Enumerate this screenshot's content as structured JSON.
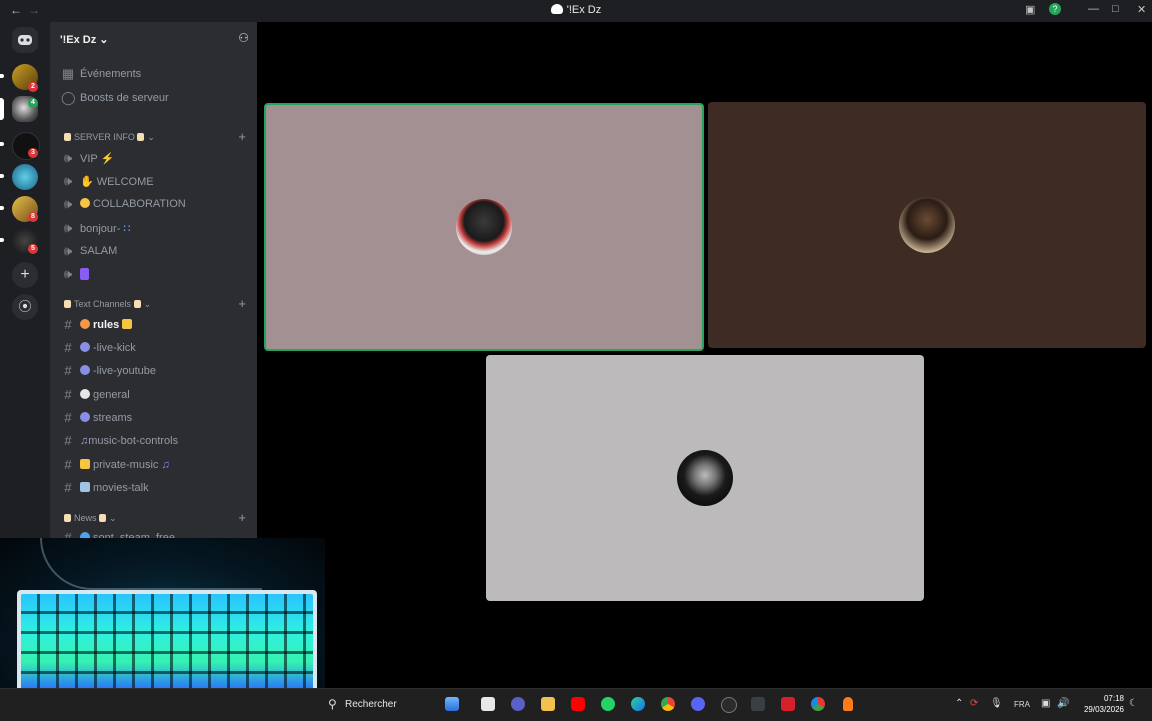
{
  "window": {
    "title": "'!Ex Dz"
  },
  "server": {
    "name": "'!Ex Dz",
    "top_items": [
      "Événements",
      "Boosts de serveur"
    ],
    "badges": [
      "2",
      "4",
      "3",
      "8",
      "8",
      "5"
    ]
  },
  "categories": {
    "server_info": "SERVER INFO",
    "text_channels": "Text Channels",
    "news": "News"
  },
  "voice_channels": [
    {
      "label": "VIP"
    },
    {
      "label": "WELCOME"
    },
    {
      "label": "COLLABORATION"
    },
    {
      "label": "bonjour-"
    },
    {
      "label": "SALAM"
    },
    {
      "label": ""
    }
  ],
  "text_channels": [
    {
      "label": "rules"
    },
    {
      "label": "-live-kick"
    },
    {
      "label": "-live-youtube"
    },
    {
      "label": "general"
    },
    {
      "label": "streams"
    },
    {
      "label": "music-bot-controls"
    },
    {
      "label": "private-music"
    },
    {
      "label": "movies-talk"
    }
  ],
  "news_channels": [
    {
      "label": "sont_steam_free"
    }
  ],
  "colors": {
    "tile1": "#a39093",
    "tile2": "#3e2b23",
    "tile3": "#bcbabb",
    "speaking_outline": "#23a55a",
    "accent": "#5865f2"
  },
  "taskbar": {
    "search_label": "Rechercher",
    "language": "FRA",
    "time": "07:18",
    "date": "29/03/2026"
  }
}
